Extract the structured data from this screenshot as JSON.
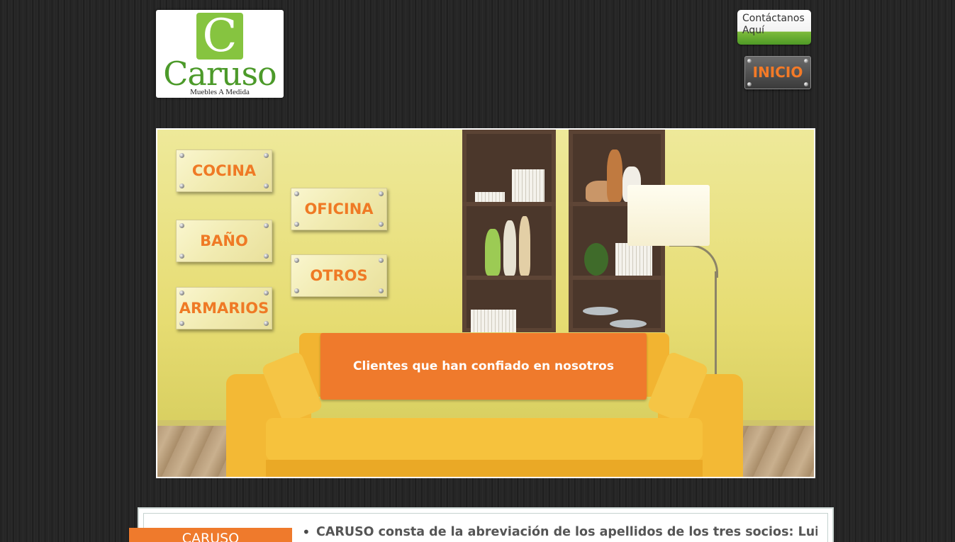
{
  "header": {
    "logo": {
      "mark_letter": "C",
      "wordmark": "Caruso",
      "tagline": "Muebles A Medida",
      "colors": {
        "mark": "#86c440",
        "wordmark": "#4c9a2a"
      }
    },
    "contact_button": {
      "line1": "Contáctanos",
      "line2": "Aquí"
    },
    "inicio_button": {
      "label": "INICIO",
      "color": "#f47a27"
    }
  },
  "hero": {
    "nav": [
      {
        "id": "cocina",
        "label": "COCINA"
      },
      {
        "id": "oficina",
        "label": "OFICINA"
      },
      {
        "id": "bano",
        "label": "BAÑO"
      },
      {
        "id": "otros",
        "label": "OTROS"
      },
      {
        "id": "armarios",
        "label": "ARMARIOS"
      }
    ],
    "cta": {
      "label": "Clientes que han confiado en nosotros",
      "color": "#ef7a2c"
    }
  },
  "about": {
    "tab_label": "CARUSO",
    "text": "CARUSO consta de la abreviación de los apellidos de los tres socios: Luis"
  }
}
